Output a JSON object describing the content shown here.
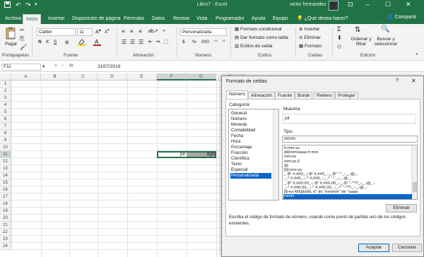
{
  "titlebar": {
    "title": "Libro7 - Excel",
    "user": "victor hernandez",
    "qat_icons": [
      "save-icon",
      "undo-icon",
      "redo-icon",
      "qat-customize-icon"
    ]
  },
  "tabs": [
    "Archivo",
    "Inicio",
    "Insertar",
    "Disposición de página",
    "Fórmulas",
    "Datos",
    "Revisar",
    "Vista",
    "Programador",
    "Ayuda",
    "Equipo"
  ],
  "active_tab": "Inicio",
  "tellme": "¿Qué desea hacer?",
  "share_label": "Compartir",
  "ribbon": {
    "clipboard": {
      "label": "Portapapeles",
      "paste": "Pegar"
    },
    "font": {
      "label": "Fuente",
      "name": "Calibri",
      "size": "11",
      "bold": "N",
      "italic": "K",
      "underline": "S"
    },
    "alignment": {
      "label": "Alineación"
    },
    "number": {
      "label": "Número",
      "format": "Personalizada",
      "currency": "$",
      "percent": "%",
      "thousands": "000"
    },
    "styles": {
      "label": "Estilos",
      "conditional": "Formato condicional",
      "as_table": "Dar formato como tabla",
      "cell_styles": "Estilos de celda"
    },
    "cells": {
      "label": "Celdas",
      "insert": "Insertar",
      "delete": "Eliminar",
      "format": "Formato"
    },
    "editing": {
      "label": "Edición",
      "sort": "Ordenar y filtrar",
      "find": "Buscar y seleccionar"
    }
  },
  "formula_bar": {
    "name_box": "F11",
    "fx": "fx",
    "value": "31/07/2019"
  },
  "grid": {
    "columns": [
      "A",
      "B",
      "C",
      "D",
      "E",
      "F",
      "G",
      "H"
    ],
    "selected_columns": [
      "F",
      "G"
    ],
    "rows": [
      "1",
      "2",
      "3",
      "4",
      "5",
      "6",
      "7",
      "8",
      "9",
      "10",
      "11",
      "12",
      "13",
      "14",
      "15",
      "16",
      "17",
      "18",
      "19",
      "20",
      "21",
      "22",
      "23",
      "24"
    ],
    "selected_row": "11",
    "cells": {
      "F11": "jul",
      "G11": "ago"
    }
  },
  "dialog": {
    "title": "Formato de celdas",
    "help": "?",
    "close": "✕",
    "tabs": [
      "Número",
      "Alineación",
      "Fuente",
      "Borde",
      "Relleno",
      "Proteger"
    ],
    "active_tab": "Número",
    "category_label": "Categoría:",
    "categories": [
      "General",
      "Número",
      "Moneda",
      "Contabilidad",
      "Fecha",
      "Hora",
      "Porcentaje",
      "Fracción",
      "Científica",
      "Texto",
      "Especial",
      "Personalizada"
    ],
    "selected_category": "Personalizada",
    "sample_label": "Muestra",
    "sample_value": "jul",
    "type_label": "Tipo:",
    "type_value": "mmm",
    "types": [
      "h:mm:ss",
      "dd/mm/aaaa h:mm",
      "mm:ss",
      "mm:ss.0",
      "@",
      "[h]:mm:ss",
      "_-$* #,##0_-;-$* #,##0_-;_-$* \"-\"_-;_-@_-",
      "_-* #,##0_-;-* #,##0_-;_-* \"-\"_-;_-@_-",
      "_-$* #,##0.00_-;-$* #,##0.00_-;_-$* \"-\"??_-;_-@_-",
      "_-* #,##0.00_-;-* #,##0.00_-;_-* \"-\"??_-;_-@_-",
      "[$-es-MX]dddd, d\" de \"mmmm\" de \"aaaa",
      "mmm"
    ],
    "selected_type": "mmm",
    "delete_button": "Eliminar",
    "description": "Escriba el código de formato de número, usando como punto de partida uno de los códigos existentes.",
    "ok_button": "Aceptar",
    "cancel_button": "Cancelar"
  },
  "colors": {
    "excel_green": "#217346",
    "selection_blue": "#0a64c8",
    "ribbon_bg": "#f3f3f3"
  }
}
